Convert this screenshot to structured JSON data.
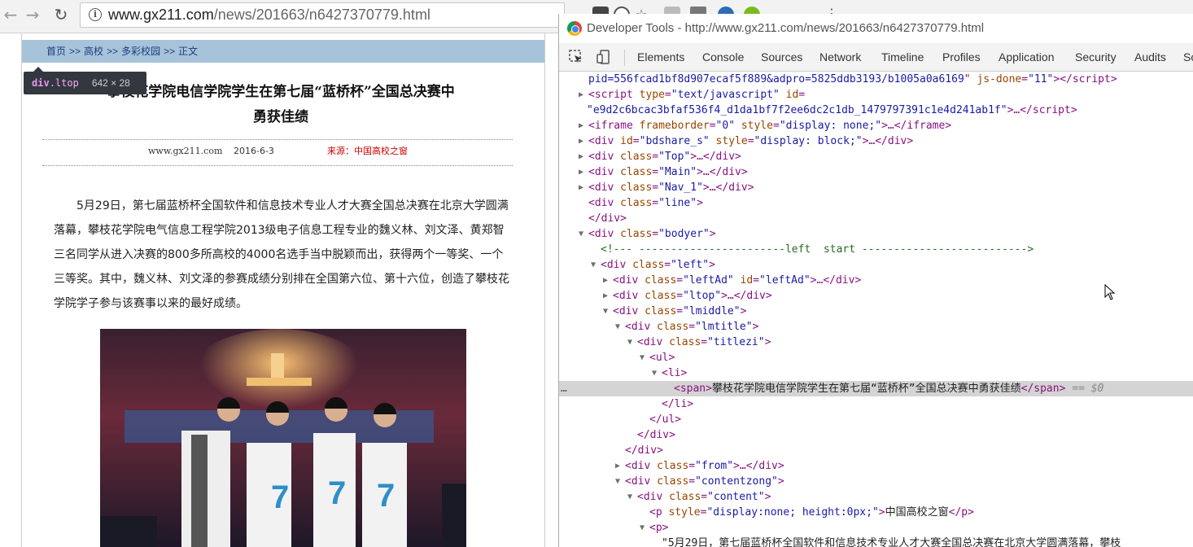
{
  "browser": {
    "url_host": "www.gx211.com",
    "url_path": "/news/201663/n6427370779.html"
  },
  "page": {
    "breadcrumb": [
      "首页",
      "高校",
      "多彩校园",
      "正文"
    ],
    "breadcrumb_sep": ">>",
    "tooltip": {
      "tag": "div",
      "cls": ".ltop",
      "size": "642 × 28"
    },
    "title_line1": "攀枝花学院电信学院学生在第七届“蓝桥杯”全国总决赛中",
    "title_line2": "勇获佳绩",
    "meta_site": "www.gx211.com",
    "meta_date": "2016-6-3",
    "meta_source": "来源：中国高校之窗",
    "body": "5月29日，第七届蓝桥杯全国软件和信息技术专业人才大赛全国总决赛在北京大学圆满落幕，攀枝花学院电气信息工程学院2013级电子信息工程专业的魏义林、刘文泽、黄郑智三名同学从进入决赛的800多所高校的4000名选手当中脱颖而出，获得两个一等奖、一个三等奖。其中，魏义林、刘文泽的参赛成绩分别排在全国第六位、第十六位，创造了攀枝花学院学子参与该赛事以来的最好成绩。"
  },
  "devtools": {
    "title": "Developer Tools - http://www.gx211.com/news/201663/n6427370779.html",
    "tabs": [
      "Elements",
      "Console",
      "Sources",
      "Network",
      "Timeline",
      "Profiles",
      "Application",
      "Security",
      "Audits",
      "Sc"
    ],
    "dom": [
      {
        "indent": 0,
        "html": "<span class='v'>pid=556fcad1bf8d907ecaf5f889&amp;adpro=5825ddb3193/b1005a0a6169</span><span class='t'>\"</span> <span class='a'>js-done</span><span class='t'>=</span><span class='v'>\"11\"</span><span class='t'>&gt;&lt;/script&gt;</span>"
      },
      {
        "indent": 0,
        "tw": "▶",
        "html": "<span class='t'>&lt;script </span><span class='a'>type</span><span class='t'>=</span><span class='v'>\"text/javascript\"</span> <span class='a'>id</span><span class='t'>=</span>"
      },
      {
        "indent": -1,
        "html": "<span class='v'>\"e9d2c6bcac3bfaf536f4_d1da1bf7f2ee6dc2c1db_1479797391c1e4d241ab1f\"</span><span class='t'>&gt;…&lt;/script&gt;</span>"
      },
      {
        "indent": 0,
        "tw": "▶",
        "html": "<span class='t'>&lt;iframe </span><span class='a'>frameborder</span><span class='t'>=</span><span class='v'>\"0\"</span> <span class='a'>style</span><span class='t'>=</span><span class='v'>\"display: none;\"</span><span class='t'>&gt;…&lt;/iframe&gt;</span>"
      },
      {
        "indent": 0,
        "tw": "▶",
        "html": "<span class='t'>&lt;div </span><span class='a'>id</span><span class='t'>=</span><span class='v'>\"bdshare_s\"</span> <span class='a'>style</span><span class='t'>=</span><span class='v'>\"display: block;\"</span><span class='t'>&gt;…&lt;/div&gt;</span>"
      },
      {
        "indent": 0,
        "tw": "▶",
        "html": "<span class='t'>&lt;div </span><span class='a'>class</span><span class='t'>=</span><span class='v'>\"Top\"</span><span class='t'>&gt;…&lt;/div&gt;</span>"
      },
      {
        "indent": 0,
        "tw": "▶",
        "html": "<span class='t'>&lt;div </span><span class='a'>class</span><span class='t'>=</span><span class='v'>\"Main\"</span><span class='t'>&gt;…&lt;/div&gt;</span>"
      },
      {
        "indent": 0,
        "tw": "▶",
        "html": "<span class='t'>&lt;div </span><span class='a'>class</span><span class='t'>=</span><span class='v'>\"Nav_1\"</span><span class='t'>&gt;…&lt;/div&gt;</span>"
      },
      {
        "indent": 0,
        "html": "<span class='t'>&lt;div </span><span class='a'>class</span><span class='t'>=</span><span class='v'>\"line\"</span><span class='t'>&gt;</span>"
      },
      {
        "indent": 0,
        "html": "<span class='t'>&lt;/div&gt;</span>"
      },
      {
        "indent": 0,
        "tw": "▼",
        "html": "<span class='t'>&lt;div </span><span class='a'>class</span><span class='t'>=</span><span class='v'>\"bodyer\"</span><span class='t'>&gt;</span>"
      },
      {
        "indent": 1,
        "html": "<span class='cm'>&lt;!--- -----------------------left  start --------------------------&gt;</span>"
      },
      {
        "indent": 1,
        "tw": "▼",
        "html": "<span class='t'>&lt;div </span><span class='a'>class</span><span class='t'>=</span><span class='v'>\"left\"</span><span class='t'>&gt;</span>"
      },
      {
        "indent": 2,
        "tw": "▶",
        "html": "<span class='t'>&lt;div </span><span class='a'>class</span><span class='t'>=</span><span class='v'>\"leftAd\"</span> <span class='a'>id</span><span class='t'>=</span><span class='v'>\"leftAd\"</span><span class='t'>&gt;…&lt;/div&gt;</span>"
      },
      {
        "indent": 2,
        "tw": "▶",
        "html": "<span class='t'>&lt;div </span><span class='a'>class</span><span class='t'>=</span><span class='v'>\"ltop\"</span><span class='t'>&gt;…&lt;/div&gt;</span>"
      },
      {
        "indent": 2,
        "tw": "▼",
        "html": "<span class='t'>&lt;div </span><span class='a'>class</span><span class='t'>=</span><span class='v'>\"lmiddle\"</span><span class='t'>&gt;</span>"
      },
      {
        "indent": 3,
        "tw": "▼",
        "html": "<span class='t'>&lt;div </span><span class='a'>class</span><span class='t'>=</span><span class='v'>\"lmtitle\"</span><span class='t'>&gt;</span>"
      },
      {
        "indent": 4,
        "tw": "▼",
        "html": "<span class='t'>&lt;div </span><span class='a'>class</span><span class='t'>=</span><span class='v'>\"titlezi\"</span><span class='t'>&gt;</span>"
      },
      {
        "indent": 5,
        "tw": "▼",
        "html": "<span class='t'>&lt;ul&gt;</span>"
      },
      {
        "indent": 6,
        "tw": "▼",
        "html": "<span class='t'>&lt;li&gt;</span>"
      },
      {
        "indent": 7,
        "selected": true,
        "html": "<span class='t'>&lt;span&gt;</span><span class='txt'>攀枝花学院电信学院学生在第七届“蓝桥杯”全国总决赛中勇获佳绩</span><span class='t'>&lt;/span&gt;</span> <span class='sel-mark'>== $0</span>"
      },
      {
        "indent": 6,
        "html": "<span class='t'>&lt;/li&gt;</span>"
      },
      {
        "indent": 5,
        "html": "<span class='t'>&lt;/ul&gt;</span>"
      },
      {
        "indent": 4,
        "html": "<span class='t'>&lt;/div&gt;</span>"
      },
      {
        "indent": 3,
        "html": "<span class='t'>&lt;/div&gt;</span>"
      },
      {
        "indent": 3,
        "tw": "▶",
        "html": "<span class='t'>&lt;div </span><span class='a'>class</span><span class='t'>=</span><span class='v'>\"from\"</span><span class='t'>&gt;…&lt;/div&gt;</span>"
      },
      {
        "indent": 3,
        "tw": "▼",
        "html": "<span class='t'>&lt;div </span><span class='a'>class</span><span class='t'>=</span><span class='v'>\"contentzong\"</span><span class='t'>&gt;</span>"
      },
      {
        "indent": 4,
        "tw": "▼",
        "html": "<span class='t'>&lt;div </span><span class='a'>class</span><span class='t'>=</span><span class='v'>\"content\"</span><span class='t'>&gt;</span>"
      },
      {
        "indent": 5,
        "html": "<span class='t'>&lt;p </span><span class='a'>style</span><span class='t'>=</span><span class='v'>\"display:none; height:0px;\"</span><span class='t'>&gt;</span><span class='txt'>中国高校之窗</span><span class='t'>&lt;/p&gt;</span>"
      },
      {
        "indent": 5,
        "tw": "▼",
        "html": "<span class='t'>&lt;p&gt;</span>"
      },
      {
        "indent": 6,
        "html": "<span class='txt'>\"5月29日，第七届蓝桥杯全国软件和信息技术专业人才大赛全国总决赛在北京大学圆满落幕，攀枝</span>"
      }
    ]
  },
  "colors": {
    "breadcrumb_bg": "#a7c3d9",
    "source_red": "#cc0000",
    "tag_purple": "#881280",
    "attr_brown": "#994500",
    "value_blue": "#1a1aa6"
  }
}
